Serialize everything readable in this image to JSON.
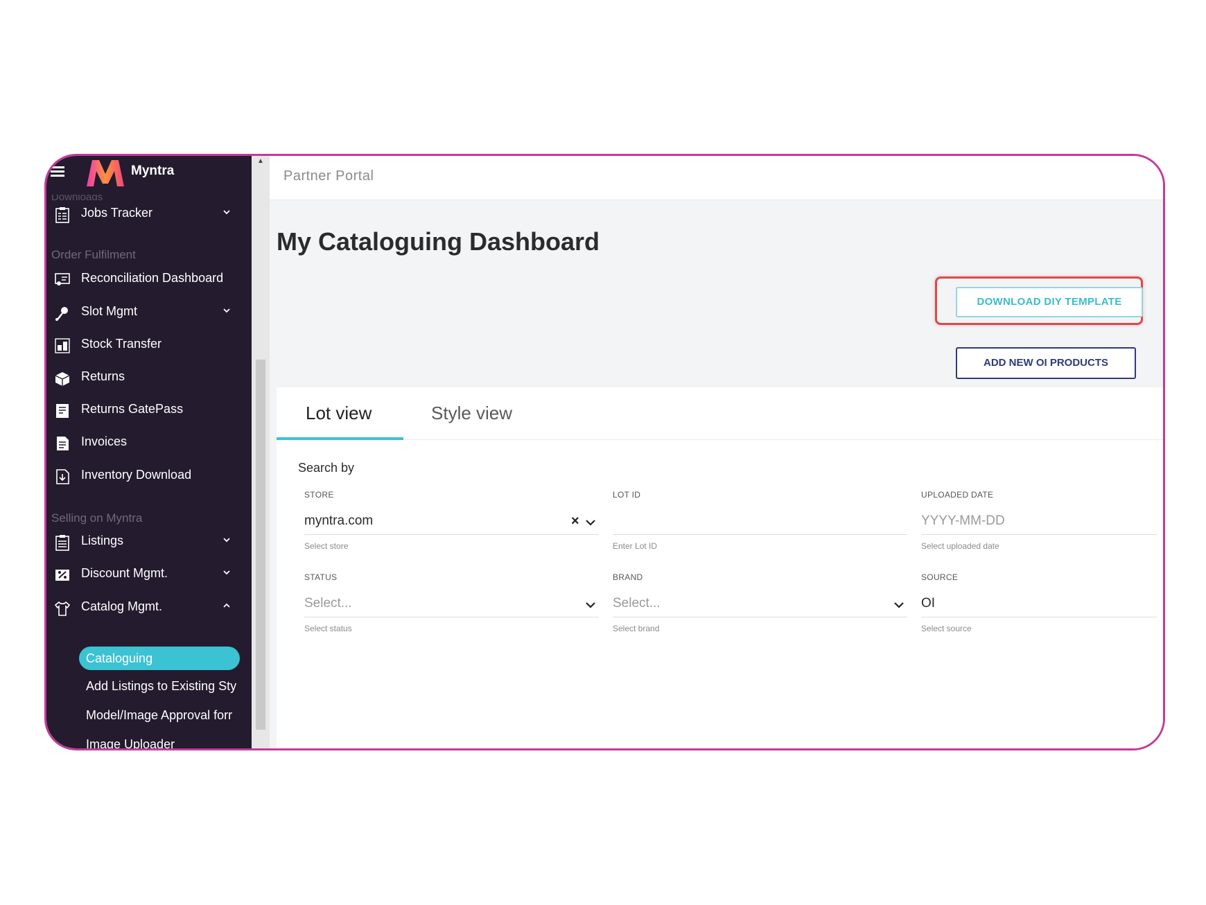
{
  "app": {
    "brand": "Myntra",
    "portal": "Partner Portal"
  },
  "sidebar": {
    "cut_label": "Downloads",
    "sections": {
      "order_fulfilment": "Order Fulfilment",
      "selling": "Selling on Myntra"
    },
    "items": [
      {
        "label": "Jobs Tracker",
        "icon": "clipboard-icon",
        "expandable": "down"
      },
      {
        "label": "Reconciliation Dashboard",
        "icon": "dashboard-icon"
      },
      {
        "label": "Slot Mgmt",
        "icon": "pin-icon",
        "expandable": "down"
      },
      {
        "label": "Stock Transfer",
        "icon": "transfer-icon"
      },
      {
        "label": "Returns",
        "icon": "box-icon"
      },
      {
        "label": "Returns GatePass",
        "icon": "gatepass-icon"
      },
      {
        "label": "Invoices",
        "icon": "document-icon"
      },
      {
        "label": "Inventory Download",
        "icon": "download-icon"
      },
      {
        "label": "Listings",
        "icon": "list-icon",
        "expandable": "down"
      },
      {
        "label": "Discount Mgmt.",
        "icon": "discount-icon",
        "expandable": "down"
      },
      {
        "label": "Catalog Mgmt.",
        "icon": "tshirt-icon",
        "expandable": "up"
      }
    ],
    "active_sub": "Cataloguing",
    "subitems": [
      "Add Listings to Existing Sty",
      "Model/Image Approval forr",
      "Image Uploader"
    ]
  },
  "main": {
    "title": "My Cataloguing Dashboard",
    "buttons": {
      "download": "DOWNLOAD DIY TEMPLATE",
      "add": "ADD NEW OI PRODUCTS"
    },
    "tabs": [
      "Lot view",
      "Style view"
    ],
    "active_tab": "Lot view",
    "search_by": "Search by",
    "fields": {
      "store": {
        "label": "STORE",
        "value": "myntra.com",
        "help": "Select store"
      },
      "lot_id": {
        "label": "LOT ID",
        "value": "",
        "help": "Enter Lot ID"
      },
      "uploaded_date": {
        "label": "UPLOADED DATE",
        "placeholder": "YYYY-MM-DD",
        "help": "Select uploaded date"
      },
      "status": {
        "label": "STATUS",
        "placeholder": "Select...",
        "help": "Select status"
      },
      "brand": {
        "label": "BRAND",
        "placeholder": "Select...",
        "help": "Select brand"
      },
      "source": {
        "label": "SOURCE",
        "value": "OI",
        "help": "Select source"
      }
    }
  },
  "colors": {
    "sidebar_bg": "#241b2e",
    "accent": "#3bc2d3",
    "frame_border": "#c43a9a",
    "highlight": "#e04848",
    "primary_button": "#2f3a78"
  }
}
